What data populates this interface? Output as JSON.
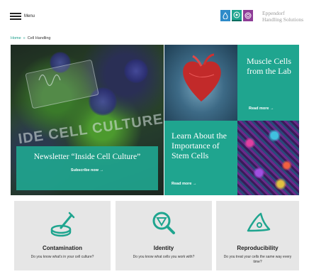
{
  "header": {
    "menu_label": "Menu",
    "brand_line1": "Eppendorf",
    "brand_line2": "Handling Solutions"
  },
  "breadcrumb": {
    "home": "Home",
    "separator": "»",
    "current": "Cell Handling"
  },
  "hero": {
    "main": {
      "overlay_text": "IDE CELL CULTURE",
      "title": "Newsletter “Inside Cell Culture”",
      "link": "Subscribe now →"
    },
    "muscle": {
      "title": "Muscle Cells from the Lab",
      "link": "Read more →"
    },
    "stem": {
      "title": "Learn About the Importance of Stem Cells",
      "link": "Read more →"
    }
  },
  "cards": [
    {
      "title": "Contamination",
      "desc": "Do you know what's in your cell culture?",
      "icon": "petri-dish-pipette-icon"
    },
    {
      "title": "Identity",
      "desc": "Do you know what cells you work with?",
      "icon": "magnifier-cell-icon"
    },
    {
      "title": "Reproducibility",
      "desc": "Do you treat your cells the same way every time?",
      "icon": "cell-shape-icon"
    }
  ],
  "colors": {
    "accent": "#1fa58f",
    "brand_blue": "#2e8bc9",
    "brand_purple": "#8e3d97"
  }
}
